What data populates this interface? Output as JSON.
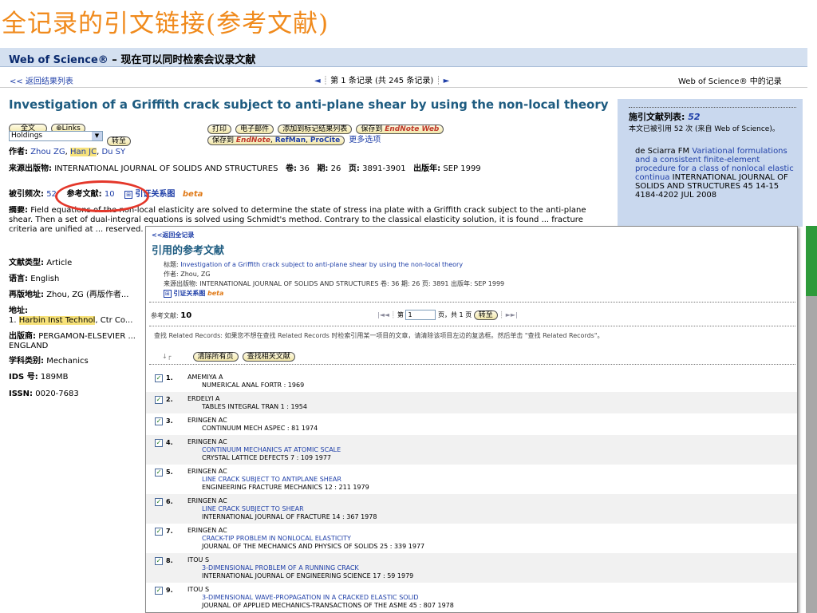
{
  "slide": {
    "title": "全记录的引文链接(参考文献)"
  },
  "header": {
    "brand_label": "Web of Science®",
    "brand_tagline": "– 现在可以同时检索会议录文献"
  },
  "nav": {
    "back": "<< 返回结果列表",
    "prev": "◄",
    "record_text": "第 1 条记录 (共 245 条记录)",
    "next": "►",
    "wos_records": "Web of Science® 中的记录"
  },
  "record": {
    "title": "Investigation of a Griffith crack subject to anti-plane shear by using the non-local theory",
    "buttons": {
      "fulltext": "全文",
      "links": "⊕Links",
      "holdings_value": "Holdings",
      "go": "转至",
      "print": "打印",
      "email": "电子邮件",
      "add_marked": "添加到标记结果列表",
      "save_to": "保存到",
      "save_to_endnote_web": "EndNote Web",
      "save_to_2": "保存到",
      "save_endnote": "EndNote",
      "save_refman": "RefMan",
      "save_procite": "ProCite",
      "more_options": "更多选项"
    },
    "author_label": "作者:",
    "authors": [
      "Zhou ZG",
      "Han JC",
      "Du SY"
    ],
    "source_label": "来源出版物:",
    "source": "INTERNATIONAL JOURNAL OF SOLIDS AND STRUCTURES",
    "volume_label": "卷:",
    "volume": "36",
    "issue_label": "期:",
    "issue": "26",
    "pages_label": "页:",
    "pages": "3891-3901",
    "year_label": "出版年:",
    "year": "SEP 1999",
    "times_cited_label": "被引频次:",
    "times_cited": "52",
    "references_label": "参考文献:",
    "references": "10",
    "citation_map": "引证关系图",
    "beta": "beta",
    "abstract_label": "摘要:",
    "abstract": "Field equations of the non-local elasticity are solved to determine the state of stress ina plate with a Griffith crack subject to the anti-plane shear. Then a set of dual-integral equations is solved using Schmidt's method. Contrary to the classical elasticity solution, it is found ... fracture criteria are unified at ... reserved.",
    "doctype_label": "文献类型:",
    "doctype": "Article",
    "language_label": "语言:",
    "language": "English",
    "reprint_label": "再版地址:",
    "reprint": "Zhou, ZG (再版作者...",
    "address_label": "地址:",
    "address_num": "1.",
    "address_inst": "Harbin Inst Technol",
    "address_rest": ", Ctr Co...",
    "publisher_label": "出版商:",
    "publisher": "PERGAMON-ELSEVIER ... ENGLAND",
    "subject_label": "学科类别:",
    "subject": "Mechanics",
    "ids_label": "IDS 号:",
    "ids": "189MB",
    "issn_label": "ISSN:",
    "issn": "0020-7683"
  },
  "cited_panel": {
    "header": "施引文献列表:",
    "count": "52",
    "count_text": "本文已被引用 52 次 (来自 Web of Science)。",
    "first_author": "de Sciarra FM",
    "first_title": "Variational formulations and a consistent finite-element procedure for a class of nonlocal elastic continua",
    "first_source": "INTERNATIONAL JOURNAL OF SOLIDS AND STRUCTURES 45 14-15 4184-4202 JUL 2008"
  },
  "popup": {
    "back": "<<返回全记录",
    "title": "引用的参考文献",
    "meta_title_label": "标题:",
    "meta_title": "Investigation of a Griffith crack subject to anti-plane shear by using the non-local theory",
    "meta_author_label": "作者:",
    "meta_author": "Zhou, ZG",
    "meta_source_label": "来源出版物:",
    "meta_source": "INTERNATIONAL JOURNAL OF SOLIDS AND STRUCTURES 卷: 36 期: 26 页: 3891 出版年: SEP 1999",
    "citation_map": "引证关系图",
    "beta": "beta",
    "refcount_label": "参考文献:",
    "refcount": "10",
    "pager_first": "|◄◄",
    "pager_page": "第",
    "page_value": "1",
    "pager_total": "页，共 1 页",
    "go": "转至",
    "pager_last": "►►|",
    "instructions": "查找 Related Records: 如果您不想在查找 Related Records 时检索引用某一项目的文章，请清除该项目左边的复选框。然后单击 \"查找 Related Records\"。",
    "clear_all": "清除所有页",
    "find_related": "查找相关文献",
    "refs": [
      {
        "num": "1.",
        "author": "AMEMIYA A",
        "title": "",
        "source": "NUMERICAL ANAL FORTR : 1969"
      },
      {
        "num": "2.",
        "author": "ERDELYI A",
        "title": "",
        "source": "TABLES INTEGRAL TRAN 1 : 1954"
      },
      {
        "num": "3.",
        "author": "ERINGEN AC",
        "title": "",
        "source": "CONTINUUM MECH ASPEC : 81 1974"
      },
      {
        "num": "4.",
        "author": "ERINGEN AC",
        "title": "CONTINUUM MECHANICS AT ATOMIC SCALE",
        "source": "CRYSTAL LATTICE DEFECTS 7 : 109 1977"
      },
      {
        "num": "5.",
        "author": "ERINGEN AC",
        "title": "LINE CRACK SUBJECT TO ANTIPLANE SHEAR",
        "source": "ENGINEERING FRACTURE MECHANICS 12 : 211 1979"
      },
      {
        "num": "6.",
        "author": "ERINGEN AC",
        "title": "LINE CRACK SUBJECT TO SHEAR",
        "source": "INTERNATIONAL JOURNAL OF FRACTURE 14 : 367 1978"
      },
      {
        "num": "7.",
        "author": "ERINGEN AC",
        "title": "CRACK-TIP PROBLEM IN NONLOCAL ELASTICITY",
        "source": "JOURNAL OF THE MECHANICS AND PHYSICS OF SOLIDS 25 : 339 1977"
      },
      {
        "num": "8.",
        "author": "ITOU S",
        "title": "3-DIMENSIONAL PROBLEM OF A RUNNING CRACK",
        "source": "INTERNATIONAL JOURNAL OF ENGINEERING SCIENCE 17 : 59 1979"
      },
      {
        "num": "9.",
        "author": "ITOU S",
        "title": "3-DIMENSIONAL WAVE-PROPAGATION IN A CRACKED ELASTIC SOLID",
        "source": "JOURNAL OF APPLIED MECHANICS-TRANSACTIONS OF THE ASME 45 : 807 1978"
      }
    ]
  },
  "colors": {
    "slide_title": "#f08a1c",
    "record_title": "#1d5b80",
    "annotation_ellipse": "#e4372a",
    "cited_panel": "#c9d8ee"
  }
}
